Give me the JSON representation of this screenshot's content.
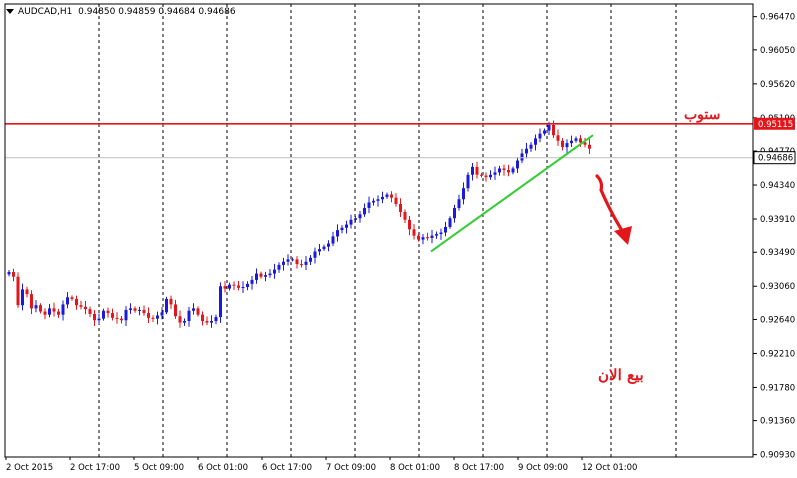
{
  "header": {
    "symbol": "AUDCAD,H1",
    "ohlc": "0.94850 0.94859 0.94684 0.94686"
  },
  "annotations": {
    "stop_label": "ستوب",
    "sell_label": "بيع الان"
  },
  "colors": {
    "bull": "#1a1adc",
    "bear": "#e3161b",
    "resistance": "#e3161b",
    "trendline": "#33cc33",
    "arrow": "#e3161b",
    "grid": "#000000"
  },
  "chart_data": {
    "type": "candlestick",
    "ylim": [
      0.909,
      0.9663
    ],
    "y_ticks": [
      "0.96470",
      "0.96050",
      "0.95620",
      "0.95190",
      "0.94770",
      "0.94340",
      "0.93910",
      "0.93490",
      "0.93060",
      "0.92640",
      "0.92210",
      "0.91780",
      "0.91360",
      "0.90930"
    ],
    "x_labels": [
      "2 Oct 2015",
      "2 Oct 17:00",
      "5 Oct 09:00",
      "6 Oct 01:00",
      "6 Oct 17:00",
      "7 Oct 09:00",
      "8 Oct 01:00",
      "8 Oct 17:00",
      "9 Oct 09:00",
      "12 Oct 01:00"
    ],
    "price_labels": {
      "resistance": "0.95115",
      "current": "0.94686"
    },
    "resistance_level": 0.95115,
    "current_price": 0.94686,
    "trend_line": [
      {
        "x": "8 Oct 07:00",
        "y": 0.935
      },
      {
        "x": "9 Oct 20:00",
        "y": 0.9497
      }
    ],
    "close_path": [
      0.9324,
      0.9318,
      0.9282,
      0.9302,
      0.9296,
      0.9278,
      0.9282,
      0.9274,
      0.927,
      0.9278,
      0.9274,
      0.927,
      0.9283,
      0.9292,
      0.929,
      0.9282,
      0.928,
      0.9277,
      0.9271,
      0.9263,
      0.9265,
      0.9275,
      0.9272,
      0.9266,
      0.9265,
      0.9263,
      0.9276,
      0.9278,
      0.9275,
      0.9276,
      0.9272,
      0.9266,
      0.9265,
      0.9269,
      0.9273,
      0.929,
      0.9283,
      0.9268,
      0.926,
      0.9262,
      0.9275,
      0.9278,
      0.927,
      0.9262,
      0.926,
      0.9262,
      0.9267,
      0.9306,
      0.9303,
      0.9308,
      0.9307,
      0.9304,
      0.9305,
      0.9309,
      0.9314,
      0.9322,
      0.9318,
      0.932,
      0.9322,
      0.9327,
      0.9333,
      0.9337,
      0.934,
      0.934,
      0.9334,
      0.9333,
      0.9337,
      0.9342,
      0.935,
      0.9353,
      0.9356,
      0.936,
      0.9369,
      0.9377,
      0.938,
      0.9384,
      0.939,
      0.9392,
      0.9397,
      0.9405,
      0.9412,
      0.9414,
      0.9416,
      0.9419,
      0.9422,
      0.9418,
      0.941,
      0.94,
      0.939,
      0.9378,
      0.937,
      0.9365,
      0.9368,
      0.9367,
      0.937,
      0.9372,
      0.9374,
      0.9381,
      0.9392,
      0.9405,
      0.9416,
      0.943,
      0.9447,
      0.9457,
      0.9447,
      0.9446,
      0.9444,
      0.9447,
      0.945,
      0.9455,
      0.9453,
      0.945,
      0.9455,
      0.9465,
      0.9474,
      0.948,
      0.9485,
      0.9493,
      0.9499,
      0.9503,
      0.951,
      0.9497,
      0.949,
      0.9482,
      0.9487,
      0.949,
      0.9493,
      0.9488,
      0.9485,
      0.948
    ]
  }
}
